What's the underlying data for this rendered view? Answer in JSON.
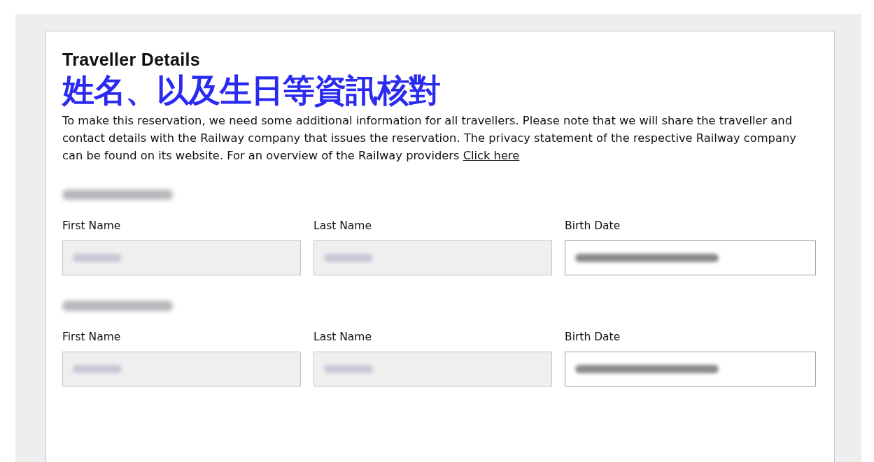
{
  "overlay_caption": "姓名、以及生日等資訊核對",
  "form": {
    "title": "Traveller Details",
    "intro": {
      "text": "To make this reservation, we need some additional information for all travellers. Please note that we will share the traveller and contact details with the Railway company that issues the reservation. The privacy statement of the respective Railway company can be found on its website. For an overview of the Railway providers",
      "link": "Click here"
    },
    "travellers": [
      {
        "fields": [
          {
            "label": "First Name",
            "disabled": true
          },
          {
            "label": "Last Name",
            "disabled": true
          },
          {
            "label": "Birth Date",
            "disabled": false
          }
        ]
      },
      {
        "fields": [
          {
            "label": "First Name",
            "disabled": true
          },
          {
            "label": "Last Name",
            "disabled": true
          },
          {
            "label": "Birth Date",
            "disabled": false
          }
        ]
      }
    ]
  }
}
